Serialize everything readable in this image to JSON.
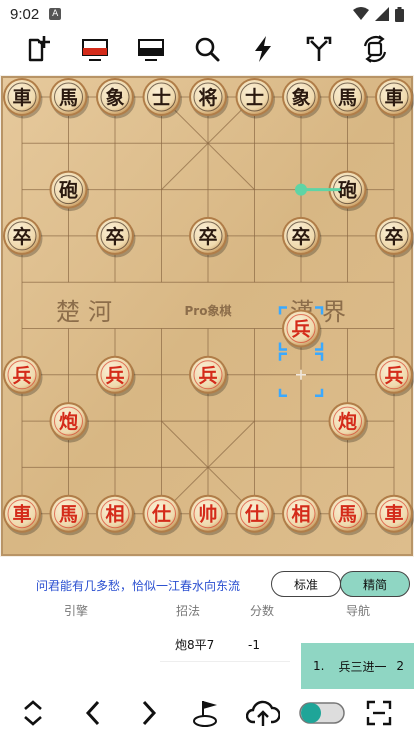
{
  "status_bar": {
    "time": "9:02",
    "badge": "A"
  },
  "toolbar": {
    "icons": [
      "add-page-icon",
      "red-board-icon",
      "black-board-icon",
      "search-icon",
      "lightning-icon",
      "branch-icon",
      "rotate-icon"
    ]
  },
  "board": {
    "river_left": "楚河",
    "river_right": "漢界",
    "watermark": "Pro象棋",
    "colors": {
      "wood": "#d9b88a",
      "line": "#8b6a45",
      "red": "#d42b1a",
      "black": "#2b1a10",
      "highlight": "#3aa9ff",
      "arrow": "#5fd4a5"
    }
  },
  "pieces": [
    {
      "side": "black",
      "label": "車",
      "file": 0,
      "rank": 0
    },
    {
      "side": "black",
      "label": "馬",
      "file": 1,
      "rank": 0
    },
    {
      "side": "black",
      "label": "象",
      "file": 2,
      "rank": 0
    },
    {
      "side": "black",
      "label": "士",
      "file": 3,
      "rank": 0
    },
    {
      "side": "black",
      "label": "将",
      "file": 4,
      "rank": 0
    },
    {
      "side": "black",
      "label": "士",
      "file": 5,
      "rank": 0
    },
    {
      "side": "black",
      "label": "象",
      "file": 6,
      "rank": 0
    },
    {
      "side": "black",
      "label": "馬",
      "file": 7,
      "rank": 0
    },
    {
      "side": "black",
      "label": "車",
      "file": 8,
      "rank": 0
    },
    {
      "side": "black",
      "label": "砲",
      "file": 1,
      "rank": 2
    },
    {
      "side": "black",
      "label": "砲",
      "file": 7,
      "rank": 2
    },
    {
      "side": "black",
      "label": "卒",
      "file": 0,
      "rank": 3
    },
    {
      "side": "black",
      "label": "卒",
      "file": 2,
      "rank": 3
    },
    {
      "side": "black",
      "label": "卒",
      "file": 4,
      "rank": 3
    },
    {
      "side": "black",
      "label": "卒",
      "file": 6,
      "rank": 3
    },
    {
      "side": "black",
      "label": "卒",
      "file": 8,
      "rank": 3
    },
    {
      "side": "red",
      "label": "兵",
      "file": 6,
      "rank": 5
    },
    {
      "side": "red",
      "label": "兵",
      "file": 0,
      "rank": 6
    },
    {
      "side": "red",
      "label": "兵",
      "file": 2,
      "rank": 6
    },
    {
      "side": "red",
      "label": "兵",
      "file": 4,
      "rank": 6
    },
    {
      "side": "red",
      "label": "兵",
      "file": 8,
      "rank": 6
    },
    {
      "side": "red",
      "label": "炮",
      "file": 1,
      "rank": 7
    },
    {
      "side": "red",
      "label": "炮",
      "file": 7,
      "rank": 7
    },
    {
      "side": "red",
      "label": "車",
      "file": 0,
      "rank": 9
    },
    {
      "side": "red",
      "label": "馬",
      "file": 1,
      "rank": 9
    },
    {
      "side": "red",
      "label": "相",
      "file": 2,
      "rank": 9
    },
    {
      "side": "red",
      "label": "仕",
      "file": 3,
      "rank": 9
    },
    {
      "side": "red",
      "label": "帅",
      "file": 4,
      "rank": 9
    },
    {
      "side": "red",
      "label": "仕",
      "file": 5,
      "rank": 9
    },
    {
      "side": "red",
      "label": "相",
      "file": 6,
      "rank": 9
    },
    {
      "side": "red",
      "label": "馬",
      "file": 7,
      "rank": 9
    },
    {
      "side": "red",
      "label": "車",
      "file": 8,
      "rank": 9
    }
  ],
  "last_move": {
    "from_file": 6,
    "from_rank": 6,
    "to_file": 6,
    "to_rank": 5
  },
  "hint_arrow": {
    "from_file": 6,
    "from_rank": 2,
    "to_file": 7,
    "to_rank": 2
  },
  "motto": "问君能有几多愁，恰似一江春水向东流",
  "modes": {
    "standard": "标准",
    "simple": "精简",
    "active": "simple"
  },
  "columns": {
    "engine": "引擎",
    "move": "招法",
    "score": "分数",
    "nav": "导航"
  },
  "engine_moves": [
    {
      "move": "炮8平7",
      "score": "-1"
    }
  ],
  "navigation": {
    "index": "1.",
    "move": "兵三进一",
    "count": "2"
  },
  "bottom_bar": {
    "icons": [
      "expand-collapse-icon",
      "previous-icon",
      "next-icon",
      "flag-icon",
      "cloud-upload-icon",
      "toggle-switch",
      "fullscreen-icon"
    ]
  }
}
